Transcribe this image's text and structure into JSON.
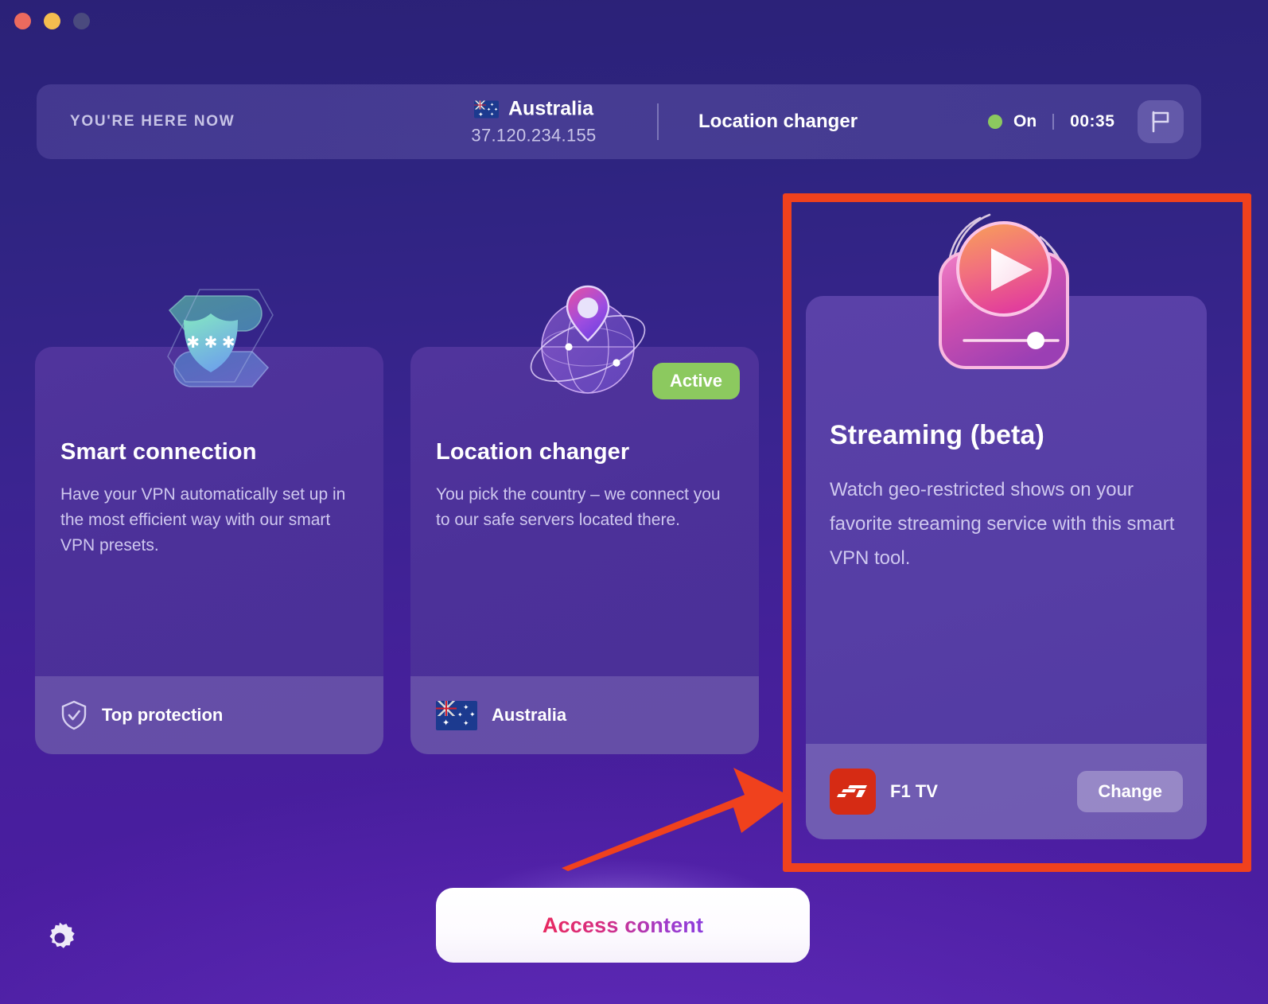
{
  "window": {
    "traffic_lights": [
      "close",
      "minimize",
      "zoom"
    ]
  },
  "status_bar": {
    "here_now_label": "YOU'RE HERE NOW",
    "country": "Australia",
    "country_flag_icon": "australia-flag-icon",
    "ip_address": "37.120.234.155",
    "mode": "Location changer",
    "connection_state": "On",
    "state_dot_color": "#8cc95f",
    "timer": "00:35",
    "flag_button_icon": "flag-icon"
  },
  "cards": {
    "smart": {
      "icon": "shield-password-icon",
      "title": "Smart connection",
      "description": "Have your VPN automatically set up in the most efficient way with our smart VPN presets.",
      "footer_icon": "shield-check-icon",
      "footer_label": "Top protection"
    },
    "location": {
      "icon": "globe-pin-icon",
      "badge": "Active",
      "badge_color": "#8cc95f",
      "title": "Location changer",
      "description": "You pick the country – we connect you to our safe servers located there.",
      "footer_icon": "australia-flag-icon",
      "footer_label": "Australia"
    },
    "streaming": {
      "icon": "video-player-icon",
      "title": "Streaming (beta)",
      "description": "Watch geo-restricted shows on your favorite streaming service with this smart VPN tool.",
      "service_icon": "f1-tv-logo-icon",
      "service_label": "F1 TV",
      "change_button": "Change"
    }
  },
  "bottom": {
    "settings_icon": "gear-icon",
    "access_button": "Access content"
  },
  "annotations": {
    "highlight_color": "#f0411d",
    "arrow_icon": "pointer-arrow-icon"
  }
}
